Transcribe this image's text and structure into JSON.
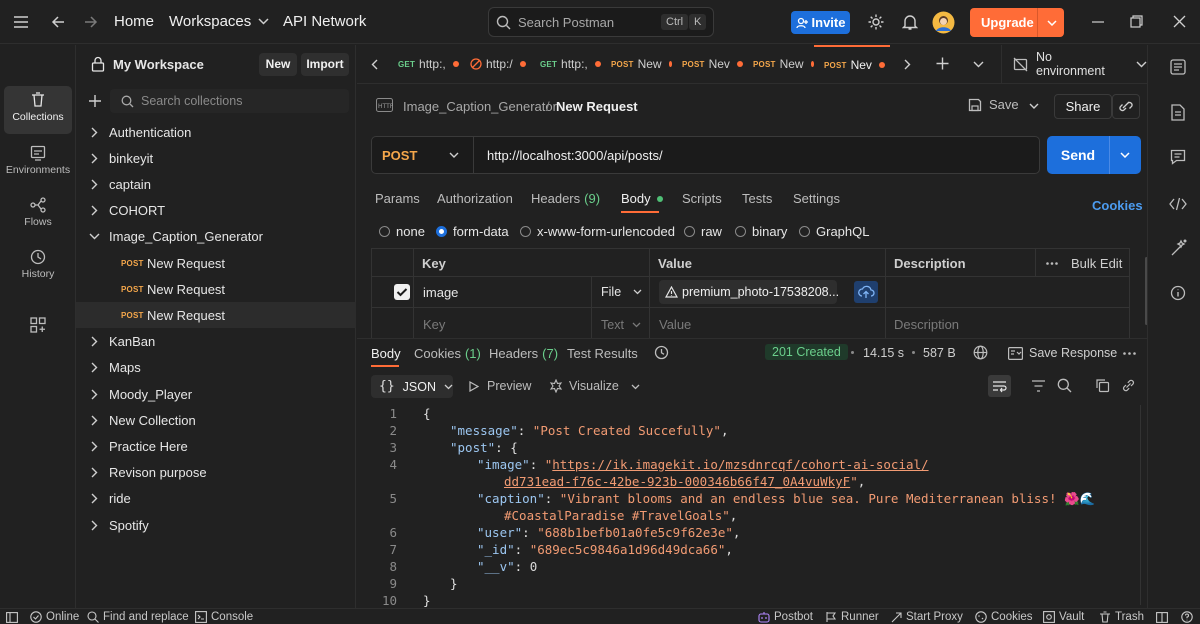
{
  "topbar": {
    "home": "Home",
    "workspaces": "Workspaces",
    "api_network": "API Network",
    "search_placeholder": "Search Postman",
    "shortcut_ctrl": "Ctrl",
    "shortcut_k": "K",
    "invite": "Invite",
    "upgrade": "Upgrade"
  },
  "rail": {
    "items": [
      {
        "label": "Collections"
      },
      {
        "label": "Environments"
      },
      {
        "label": "Flows"
      },
      {
        "label": "History"
      }
    ]
  },
  "workspace": {
    "name": "My Workspace",
    "new_button": "New",
    "import_button": "Import",
    "search_placeholder": "Search collections"
  },
  "collections": [
    {
      "name": "Authentication"
    },
    {
      "name": "binkeyit"
    },
    {
      "name": "captain"
    },
    {
      "name": "COHORT"
    },
    {
      "name": "Image_Caption_Generator"
    },
    {
      "name": "KanBan"
    },
    {
      "name": "Maps"
    },
    {
      "name": "Moody_Player"
    },
    {
      "name": "New Collection"
    },
    {
      "name": "Practice Here"
    },
    {
      "name": "Revison purpose"
    },
    {
      "name": "ride"
    },
    {
      "name": "Spotify"
    }
  ],
  "requests": [
    {
      "method": "POST",
      "name": "New Request"
    },
    {
      "method": "POST",
      "name": "New Request"
    },
    {
      "method": "POST",
      "name": "New Request"
    }
  ],
  "tabs": [
    {
      "method": "GET",
      "label": "http:,"
    },
    {
      "method": "",
      "label": "http:/"
    },
    {
      "method": "GET",
      "label": "http:,"
    },
    {
      "method": "POST",
      "label": "New"
    },
    {
      "method": "POST",
      "label": "Nev"
    },
    {
      "method": "POST",
      "label": "New"
    },
    {
      "method": "POST",
      "label": "Nev"
    }
  ],
  "environment": "No environment",
  "breadcrumb": {
    "collection": "Image_Caption_Generator",
    "separator": "/",
    "request": "New Request"
  },
  "actions": {
    "save": "Save",
    "share": "Share"
  },
  "request": {
    "method": "POST",
    "url": "http://localhost:3000/api/posts/",
    "send": "Send"
  },
  "request_tabs": {
    "params": "Params",
    "authorization": "Authorization",
    "headers": "Headers",
    "headers_count": "(9)",
    "body": "Body",
    "scripts": "Scripts",
    "tests": "Tests",
    "settings": "Settings",
    "cookies": "Cookies"
  },
  "body_types": {
    "none": "none",
    "form_data": "form-data",
    "urlencoded": "x-www-form-urlencoded",
    "raw": "raw",
    "binary": "binary",
    "graphql": "GraphQL",
    "selected": "form-data"
  },
  "form_table": {
    "headers": {
      "key": "Key",
      "value": "Value",
      "description": "Description",
      "bulk_edit": "Bulk Edit"
    },
    "row": {
      "key": "image",
      "type": "File",
      "value": "premium_photo-17538208..."
    },
    "empty_row": {
      "key": "Key",
      "type": "Text",
      "value": "Value",
      "description": "Description"
    }
  },
  "response_tabs": {
    "body": "Body",
    "cookies": "Cookies",
    "cookies_count": "(1)",
    "headers": "Headers",
    "headers_count": "(7)",
    "test_results": "Test Results",
    "status": "201 Created",
    "time": "14.15 s",
    "size": "587 B",
    "save_response": "Save Response"
  },
  "response_toolbar": {
    "format": "JSON",
    "preview": "Preview",
    "visualize": "Visualize"
  },
  "response_body": {
    "line_numbers": [
      "1",
      "2",
      "3",
      "4",
      "",
      "5",
      "",
      "6",
      "7",
      "8",
      "9",
      "10"
    ],
    "message_key": "\"message\"",
    "message_value": "\"Post Created Succefully\"",
    "post_key": "\"post\"",
    "image_key": "\"image\"",
    "image_url_1": "https://ik.imagekit.io/mzsdnrcqf/cohort-ai-social/",
    "image_url_2": "dd731ead-f76c-42be-923b-000346b66f47_0A4vuWkyF",
    "caption_key": "\"caption\"",
    "caption_1": "\"Vibrant blooms and an endless blue sea. Pure Mediterranean bliss! 🌺🌊",
    "caption_2": "#CoastalParadise #TravelGoals\"",
    "user_key": "\"user\"",
    "user_value": "\"688b1befb01a0fe5c9f62e3e\"",
    "id_key": "\"_id\"",
    "id_value": "\"689ec5c9846a1d96d49dca66\"",
    "v_key": "\"__v\"",
    "v_value": "0"
  },
  "statusbar": {
    "online": "Online",
    "find_replace": "Find and replace",
    "console": "Console",
    "postbot": "Postbot",
    "runner": "Runner",
    "start_proxy": "Start Proxy",
    "cookies": "Cookies",
    "vault": "Vault",
    "trash": "Trash"
  },
  "colors": {
    "accent": "#ff6c37",
    "primary": "#1d6fdc",
    "success": "#4fbf75",
    "post": "#f5a74b",
    "get": "#6bcf8c"
  }
}
